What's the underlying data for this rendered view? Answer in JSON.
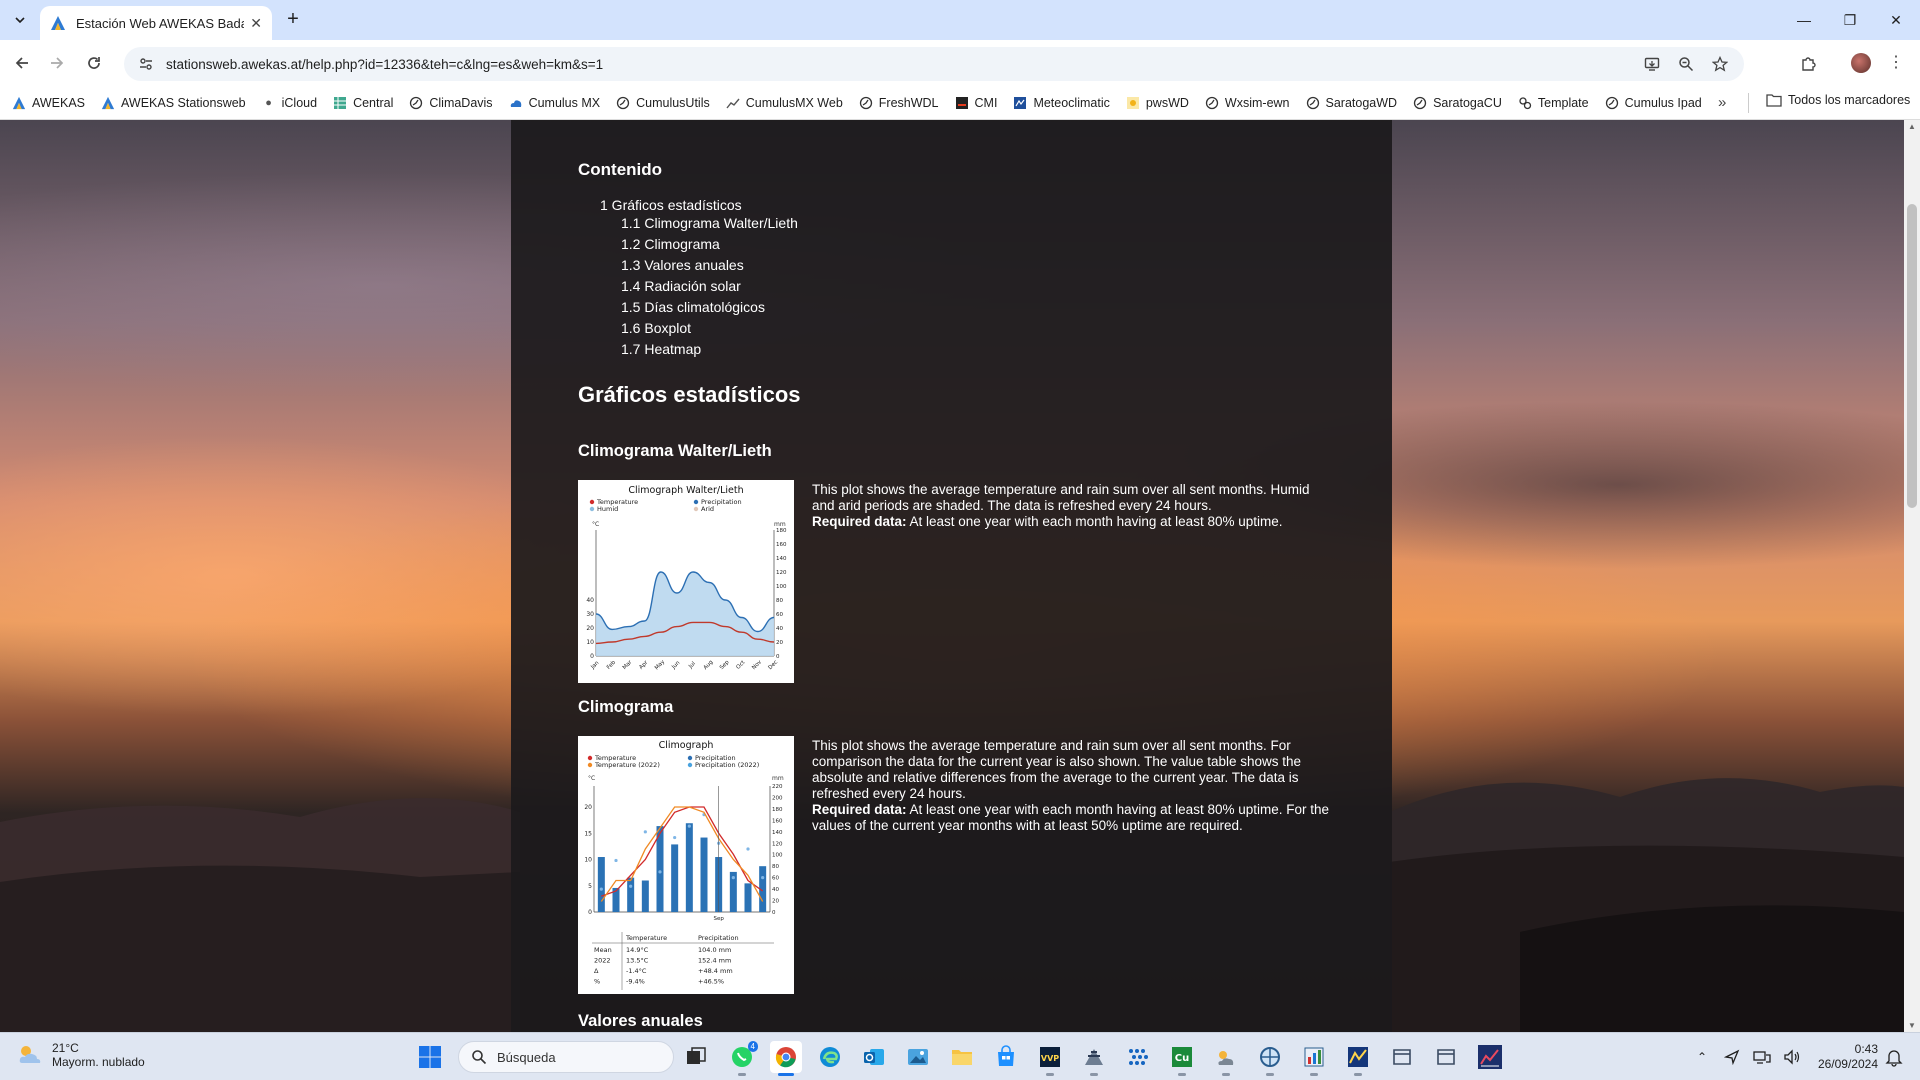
{
  "browser": {
    "tab_title": "Estación Web AWEKAS Badalon",
    "url": "stationsweb.awekas.at/help.php?id=12336&teh=c&lng=es&weh=km&s=1",
    "bookmarks": [
      "AWEKAS",
      "AWEKAS Stationsweb",
      "iCloud",
      "Central",
      "ClimaDavis",
      "Cumulus MX",
      "CumulusUtils",
      "CumulusMX Web",
      "FreshWDL",
      "CMI",
      "Meteoclimatic",
      "pwsWD",
      "Wxsim-ewn",
      "SaratogaWD",
      "SaratogaCU",
      "Template",
      "Cumulus Ipad"
    ],
    "all_bookmarks_label": "Todos los marcadores"
  },
  "page": {
    "toc": {
      "title": "Contenido",
      "l1": "1 Gráficos estadísticos",
      "items": [
        "1.1 Climograma Walter/Lieth",
        "1.2 Climograma",
        "1.3 Valores anuales",
        "1.4 Radiación solar",
        "1.5 Días climatológicos",
        "1.6 Boxplot",
        "1.7 Heatmap"
      ]
    },
    "section_title": "Gráficos estadísticos",
    "walter": {
      "heading": "Climograma Walter/Lieth",
      "text": "This plot shows the average temperature and rain sum over all sent months. Humid and arid periods are shaded. The data is refreshed every 24 hours.",
      "required_label": "Required data:",
      "required_text": " At least one year with each month having at least 80% uptime."
    },
    "climograma": {
      "heading": "Climograma",
      "text": "This plot shows the average temperature and rain sum over all sent months. For comparison the data for the current year is also shown. The value table shows the absolute and relative differences from the average to the current year. The data is refreshed every 24 hours.",
      "required_label": "Required data:",
      "required_text": " At least one year with each month having at least 80% uptime. For the values of the current year months with at least 50% uptime are required."
    },
    "next_heading": "Valores anuales"
  },
  "chart_data": [
    {
      "type": "area",
      "title": "Climograph Walter/Lieth",
      "legend": [
        "Temperature",
        "Precipitation",
        "Humid",
        "Arid"
      ],
      "ylabel_left": "°C",
      "ylabel_right": "mm",
      "left_ticks": [
        0,
        10,
        20,
        30,
        40
      ],
      "right_ticks": [
        0,
        20,
        40,
        60,
        80,
        100,
        120,
        140,
        160,
        180
      ],
      "categories": [
        "Jan",
        "Feb",
        "Mar",
        "Apr",
        "May",
        "Jun",
        "Jul",
        "Aug",
        "Sep",
        "Oct",
        "Nov",
        "Dec"
      ],
      "series": [
        {
          "name": "Temperature",
          "values": [
            9,
            10,
            12,
            14,
            17,
            21,
            24,
            24,
            21,
            17,
            12,
            10
          ]
        },
        {
          "name": "Precipitation",
          "values": [
            60,
            38,
            42,
            50,
            120,
            90,
            120,
            105,
            80,
            55,
            35,
            55
          ]
        }
      ]
    },
    {
      "type": "bar",
      "title": "Climograph",
      "legend": [
        "Temperature",
        "Precipitation",
        "Temperature (2022)",
        "Precipitation (2022)"
      ],
      "ylabel_left": "°C",
      "ylabel_right": "mm",
      "left_ticks": [
        0,
        5,
        10,
        15,
        20
      ],
      "right_ticks": [
        0,
        20,
        40,
        60,
        80,
        100,
        120,
        140,
        160,
        180,
        200,
        220
      ],
      "x_highlight": "Sep",
      "series": [
        {
          "name": "Precipitation",
          "values": [
            96,
            42,
            60,
            55,
            150,
            118,
            155,
            130,
            96,
            70,
            50,
            80
          ]
        },
        {
          "name": "Temperature",
          "values": [
            3,
            4,
            7,
            10,
            15,
            19,
            20,
            20,
            15,
            11,
            6,
            4
          ]
        },
        {
          "name": "Temperature (2022)",
          "values": [
            2,
            6,
            6,
            12,
            16,
            20,
            20,
            19,
            14,
            10,
            7,
            2
          ]
        },
        {
          "name": "Precipitation (2022)",
          "values": [
            40,
            90,
            45,
            140,
            70,
            130,
            150,
            170,
            120,
            60,
            110,
            60
          ]
        }
      ],
      "table": {
        "headers": [
          "",
          "Temperature",
          "Precipitation"
        ],
        "rows": [
          [
            "Mean",
            "14.9°C",
            "104.0 mm"
          ],
          [
            "2022",
            "13.5°C",
            "152.4 mm"
          ],
          [
            "Δ",
            "-1.4°C",
            "+48.4 mm"
          ],
          [
            "%",
            "-9.4%",
            "+46.5%"
          ]
        ]
      }
    }
  ],
  "taskbar": {
    "weather_temp": "21°C",
    "weather_desc": "Mayorm. nublado",
    "search_label": "Búsqueda",
    "whatsapp_badge": "4",
    "time": "0:43",
    "date": "26/09/2024"
  }
}
